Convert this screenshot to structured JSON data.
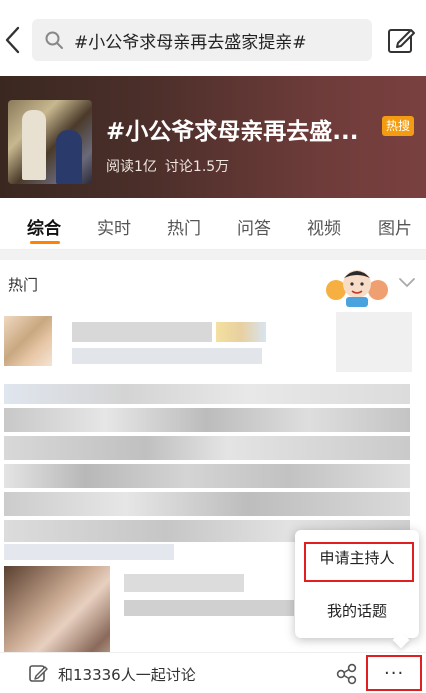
{
  "search": {
    "query": "#小公爷求母亲再去盛家提亲#"
  },
  "hero": {
    "title": "#小公爷求母亲再去盛...",
    "badge": "热搜",
    "reads": "阅读1亿",
    "discussions": "讨论1.5万"
  },
  "tabs": [
    {
      "label": "综合",
      "active": true
    },
    {
      "label": "实时"
    },
    {
      "label": "热门"
    },
    {
      "label": "问答"
    },
    {
      "label": "视频"
    },
    {
      "label": "图片"
    }
  ],
  "section": {
    "label": "热门"
  },
  "bottombar": {
    "compose": "和13336人一起讨论",
    "more": "···"
  },
  "popup": {
    "items": [
      "申请主持人",
      "我的话题"
    ]
  },
  "colors": {
    "accent": "#ff8200",
    "badge": "#f39c12",
    "highlight": "#e02020"
  },
  "icons": [
    "back-icon",
    "search-icon",
    "edit-icon",
    "chevron-down-icon",
    "compose-icon",
    "share-icon",
    "more-icon"
  ]
}
